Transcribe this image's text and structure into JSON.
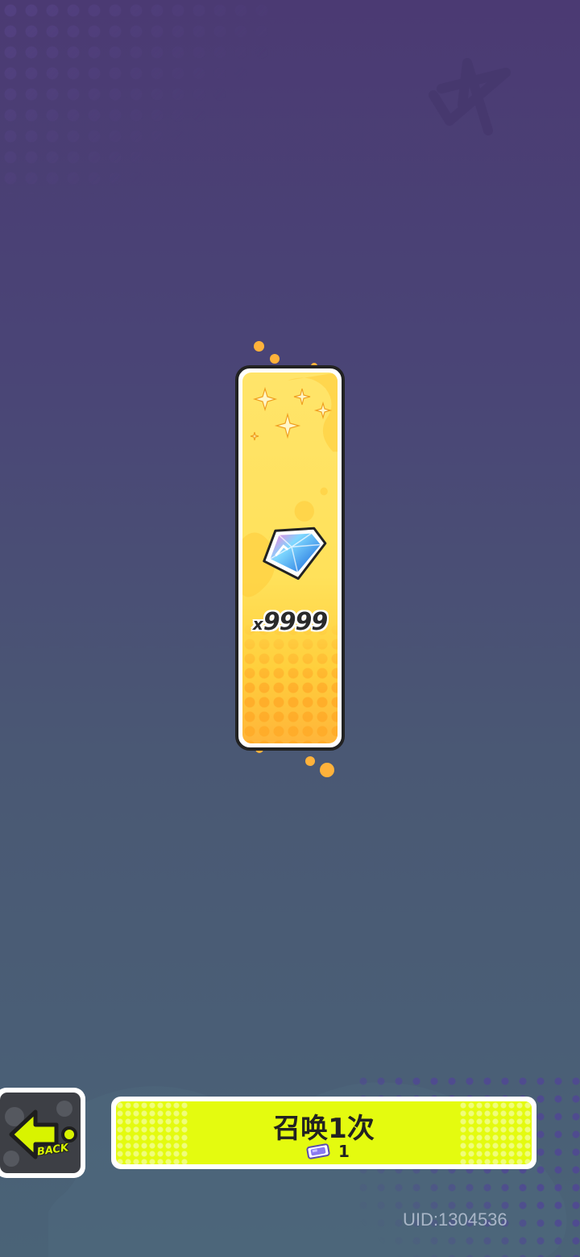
{
  "reward": {
    "item_icon": "gem-icon",
    "prefix": "x",
    "amount": "9999"
  },
  "back_button": {
    "label": "BACK",
    "icon": "back-arrow-icon"
  },
  "summon_button": {
    "label": "召唤1次",
    "cost_icon": "ticket-icon",
    "cost": "1"
  },
  "footer": {
    "uid": "UID:1304536"
  },
  "colors": {
    "card_yellow": "#ffe15a",
    "summon_lime": "#e4fb0f",
    "back_accent": "#d8f400",
    "confetti": "#ffb23b"
  }
}
